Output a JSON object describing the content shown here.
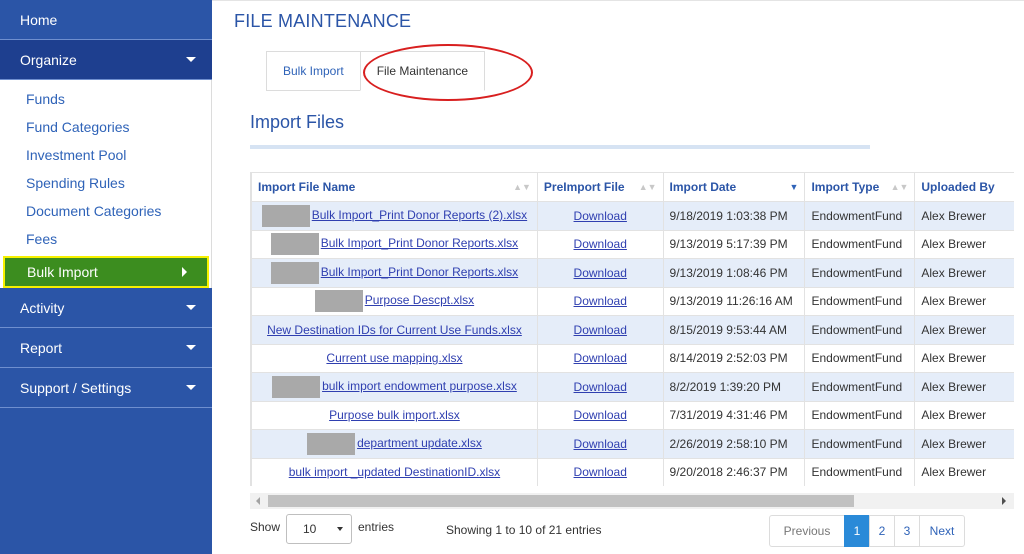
{
  "sidebar": {
    "home": "Home",
    "organize": "Organize",
    "organize_items": [
      "Funds",
      "Fund Categories",
      "Investment Pool",
      "Spending Rules",
      "Document Categories",
      "Fees"
    ],
    "active_item": "Bulk Import",
    "activity": "Activity",
    "report": "Report",
    "support": "Support / Settings"
  },
  "page": {
    "title": "FILE MAINTENANCE",
    "tabs": [
      "Bulk Import",
      "File Maintenance"
    ],
    "active_tab": "File Maintenance",
    "section_title": "Import Files"
  },
  "table": {
    "columns": [
      "Import File Name",
      "PreImport File",
      "Import Date",
      "Import Type",
      "Uploaded By"
    ],
    "sorted_column": "Import Date",
    "rows": [
      {
        "name": "Bulk Import_Print Donor Reports (2).xlsx",
        "redacted": true,
        "pre": "Download",
        "date": "9/18/2019 1:03:38 PM",
        "type": "EndowmentFund",
        "by": "Alex Brewer"
      },
      {
        "name": "Bulk Import_Print Donor Reports.xlsx",
        "redacted": true,
        "pre": "Download",
        "date": "9/13/2019 5:17:39 PM",
        "type": "EndowmentFund",
        "by": "Alex Brewer"
      },
      {
        "name": "Bulk Import_Print Donor Reports.xlsx",
        "redacted": true,
        "pre": "Download",
        "date": "9/13/2019 1:08:46 PM",
        "type": "EndowmentFund",
        "by": "Alex Brewer"
      },
      {
        "name": "Purpose Descpt.xlsx",
        "redacted": true,
        "pre": "Download",
        "date": "9/13/2019 11:26:16 AM",
        "type": "EndowmentFund",
        "by": "Alex Brewer"
      },
      {
        "name": "New Destination IDs for Current Use Funds.xlsx",
        "redacted": false,
        "pre": "Download",
        "date": "8/15/2019 9:53:44 AM",
        "type": "EndowmentFund",
        "by": "Alex Brewer"
      },
      {
        "name": "Current use mapping.xlsx",
        "redacted": false,
        "pre": "Download",
        "date": "8/14/2019 2:52:03 PM",
        "type": "EndowmentFund",
        "by": "Alex Brewer"
      },
      {
        "name": "bulk import endowment purpose.xlsx",
        "redacted": true,
        "pre": "Download",
        "date": "8/2/2019 1:39:20 PM",
        "type": "EndowmentFund",
        "by": "Alex Brewer"
      },
      {
        "name": "Purpose bulk import.xlsx",
        "redacted": false,
        "pre": "Download",
        "date": "7/31/2019 4:31:46 PM",
        "type": "EndowmentFund",
        "by": "Alex Brewer"
      },
      {
        "name": "department update.xlsx",
        "redacted": true,
        "pre": "Download",
        "date": "2/26/2019 2:58:10 PM",
        "type": "EndowmentFund",
        "by": "Alex Brewer"
      },
      {
        "name": "bulk import _updated DestinationID.xlsx",
        "redacted": false,
        "pre": "Download",
        "date": "9/20/2018 2:46:37 PM",
        "type": "EndowmentFund",
        "by": "Alex Brewer"
      }
    ]
  },
  "footer": {
    "show": "Show",
    "page_size": "10",
    "entries": "entries",
    "info": "Showing 1 to 10 of 21 entries",
    "prev": "Previous",
    "pages": [
      "1",
      "2",
      "3"
    ],
    "current_page": "1",
    "next": "Next"
  },
  "colors": {
    "sidebar_bg": "#2b55a7",
    "active_bg": "#3c8d1f",
    "highlight_border": "#f6f100",
    "annotation_red": "#d81f1f",
    "current_page": "#2a8ad8"
  }
}
